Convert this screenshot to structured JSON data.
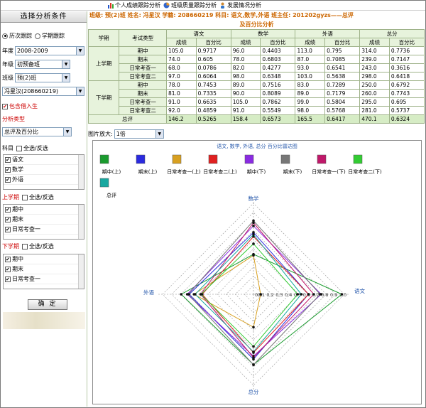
{
  "topnav": [
    {
      "label": "个人成绩跟踪分析",
      "icon": "bar-chart-icon"
    },
    {
      "label": "班级质量跟踪分析",
      "icon": "pie-chart-icon"
    },
    {
      "label": "发展情况分析",
      "icon": "person-icon"
    }
  ],
  "sidebar": {
    "title": "选择分析条件",
    "mode1": "历次跟踪",
    "mode2": "学期跟踪",
    "year_label": "年度",
    "year_value": "2008-2009",
    "grade_label": "年级",
    "grade_value": "初预备班",
    "class_label": "班级",
    "class_value": "预(2)班",
    "student_value": "冯星汉(208660219)",
    "include_transfer": "包含借入生",
    "analysis_type_label": "分析类型",
    "analysis_type_value": "总评及百分比",
    "subject_label": "科目",
    "select_all": "全选/反选",
    "subjects": [
      "语文",
      "数学",
      "外语"
    ],
    "term1_label": "上学期",
    "term2_label": "下学期",
    "exams": [
      "期中",
      "期末",
      "日常考查一"
    ],
    "confirm": "确 定"
  },
  "info": {
    "line": "班级: 预(2)班  姓名: 冯星汉  学籍: 208660219  科目: 语文,数学,外语  班主任: 201202gyzs——总评",
    "line2": "及百分比分析"
  },
  "table": {
    "headers": {
      "term": "学期",
      "exam": "考试类型",
      "subjects": [
        "语文",
        "数学",
        "外语",
        "总分"
      ],
      "score": "成绩",
      "pct": "百分比"
    },
    "rows": [
      {
        "term": "上学期",
        "exam": "期中",
        "v": [
          "105.0",
          "0.9717",
          "96.0",
          "0.4403",
          "113.0",
          "0.795",
          "314.0",
          "0.7736"
        ]
      },
      {
        "term": "",
        "exam": "期末",
        "v": [
          "74.0",
          "0.605",
          "78.0",
          "0.6803",
          "87.0",
          "0.7085",
          "239.0",
          "0.7147"
        ]
      },
      {
        "term": "",
        "exam": "日常考查一",
        "v": [
          "68.0",
          "0.0786",
          "82.0",
          "0.4277",
          "93.0",
          "0.6541",
          "243.0",
          "0.3616"
        ]
      },
      {
        "term": "",
        "exam": "日常考查二",
        "v": [
          "97.0",
          "0.6064",
          "98.0",
          "0.6348",
          "103.0",
          "0.5638",
          "298.0",
          "0.6418"
        ]
      },
      {
        "term": "下学期",
        "exam": "期中",
        "v": [
          "78.0",
          "0.7453",
          "89.0",
          "0.7516",
          "83.0",
          "0.7289",
          "250.0",
          "0.6792"
        ]
      },
      {
        "term": "",
        "exam": "期末",
        "v": [
          "81.0",
          "0.7335",
          "90.0",
          "0.8089",
          "89.0",
          "0.7179",
          "260.0",
          "0.7743"
        ]
      },
      {
        "term": "",
        "exam": "日常考查一",
        "v": [
          "91.0",
          "0.6635",
          "105.0",
          "0.7862",
          "99.0",
          "0.5804",
          "295.0",
          "0.695"
        ]
      },
      {
        "term": "",
        "exam": "日常考查二",
        "v": [
          "92.0",
          "0.4859",
          "91.0",
          "0.5549",
          "98.0",
          "0.5768",
          "281.0",
          "0.5737"
        ]
      },
      {
        "term": "总评",
        "exam": "",
        "v": [
          "146.2",
          "0.5265",
          "158.4",
          "0.6573",
          "165.5",
          "0.6417",
          "470.1",
          "0.6324"
        ]
      }
    ]
  },
  "zoom": {
    "label": "图片放大:",
    "value": "1倍"
  },
  "chart_data": {
    "type": "radar",
    "title": "语文, 数学, 外语, 总分 百分比雷达图",
    "axes": [
      "语文",
      "数学",
      "外语",
      "总分"
    ],
    "range": [
      0,
      1.0
    ],
    "ticks": [
      "0.0",
      "0.1",
      "0.2",
      "0.3",
      "0.4",
      "0.5",
      "0.6",
      "0.7",
      "0.8",
      "0.9",
      "1.0"
    ],
    "series": [
      {
        "name": "期中(上)",
        "color": "#1a9b2e",
        "values": [
          0.9717,
          0.4403,
          0.795,
          0.7736
        ]
      },
      {
        "name": "期末(上)",
        "color": "#2a2adf",
        "values": [
          0.605,
          0.6803,
          0.7085,
          0.7147
        ]
      },
      {
        "name": "日常考查一(上)",
        "color": "#d8a020",
        "values": [
          0.0786,
          0.4277,
          0.6541,
          0.3616
        ]
      },
      {
        "name": "日常考查二(上)",
        "color": "#e02020",
        "values": [
          0.6064,
          0.6348,
          0.5638,
          0.6418
        ]
      },
      {
        "name": "期中(下)",
        "color": "#8a2be2",
        "values": [
          0.7453,
          0.7516,
          0.7289,
          0.6792
        ]
      },
      {
        "name": "期末(下)",
        "color": "#777777",
        "values": [
          0.7335,
          0.8089,
          0.7179,
          0.7743
        ]
      },
      {
        "name": "日常考查一(下)",
        "color": "#c0186a",
        "values": [
          0.6635,
          0.7862,
          0.5804,
          0.695
        ]
      },
      {
        "name": "日常考查二(下)",
        "color": "#33cc33",
        "values": [
          0.4859,
          0.5549,
          0.5768,
          0.5737
        ]
      },
      {
        "name": "总评",
        "color": "#18a8a0",
        "values": [
          0.5265,
          0.6573,
          0.6417,
          0.6324
        ]
      }
    ]
  }
}
